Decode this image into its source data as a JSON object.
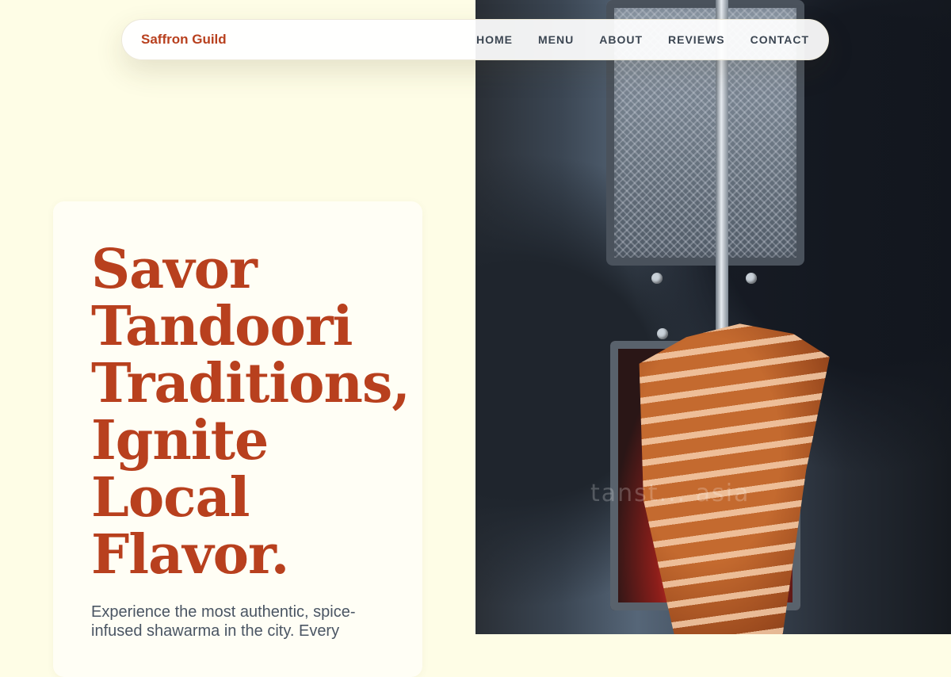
{
  "nav": {
    "brand": "Saffron Guild",
    "links": [
      "HOME",
      "MENU",
      "ABOUT",
      "REVIEWS",
      "CONTACT"
    ]
  },
  "hero": {
    "headline_lines": [
      "Savor",
      "Tandoori",
      "Traditions,",
      "Ignite",
      "Local",
      "Flavor."
    ],
    "lead": "Experience the most authentic, spice-infused shawarma in the city. Every",
    "photo_watermark": "tanst... asia"
  },
  "colors": {
    "background": "#fefde6",
    "accent": "#b8401e",
    "nav_text": "#3c4652"
  }
}
